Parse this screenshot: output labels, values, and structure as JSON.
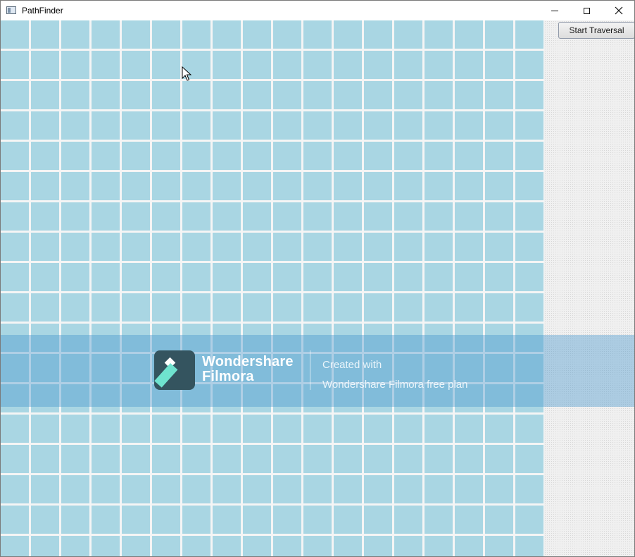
{
  "window": {
    "title": "PathFinder",
    "icon": "app-window-icon",
    "controls": {
      "minimize_icon": "minimize-icon",
      "maximize_icon": "maximize-icon",
      "close_icon": "close-icon",
      "close_glyph": "✕"
    }
  },
  "toolbar": {
    "start_label": "Start Traversal"
  },
  "grid": {
    "cell_color": "#a9d6e3",
    "line_color": "#f5f5f5",
    "cell_pitch": 43,
    "cell_size": 40
  },
  "watermark": {
    "brand_line1": "Wondershare",
    "brand_line2": "Filmora",
    "info_line1": "Created with",
    "info_line2": "Wondershare Filmora free plan"
  }
}
